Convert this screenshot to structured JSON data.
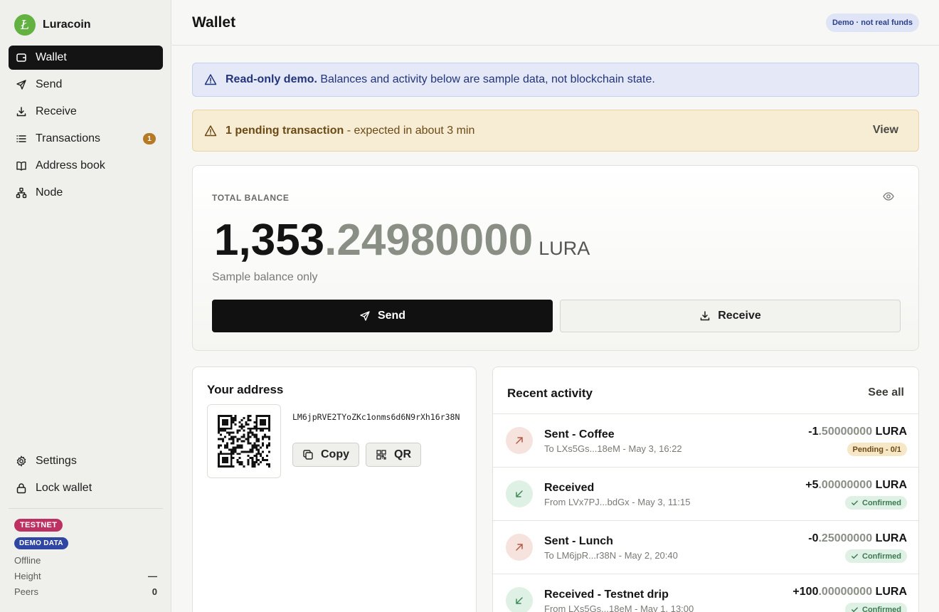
{
  "app": {
    "name": "Luracoin",
    "logo_letter": "Ł",
    "brand_color": "#62b141"
  },
  "sidebar": {
    "items": [
      {
        "label": "Wallet",
        "icon": "wallet-icon",
        "active": true
      },
      {
        "label": "Send",
        "icon": "send-icon"
      },
      {
        "label": "Receive",
        "icon": "download-icon"
      },
      {
        "label": "Transactions",
        "icon": "list-icon",
        "badge": "1"
      },
      {
        "label": "Address book",
        "icon": "book-icon"
      },
      {
        "label": "Node",
        "icon": "node-icon"
      }
    ],
    "bottom_items": [
      {
        "label": "Settings",
        "icon": "gear-icon"
      },
      {
        "label": "Lock wallet",
        "icon": "lock-icon"
      }
    ],
    "network_pill": "TESTNET",
    "data_pill": "DEMO DATA",
    "connection": "Offline",
    "stats": [
      {
        "label": "Height",
        "value": "—"
      },
      {
        "label": "Peers",
        "value": "0"
      }
    ]
  },
  "header": {
    "title": "Wallet",
    "badge": "Demo · not real funds"
  },
  "banners": {
    "info": {
      "bold": "Read-only demo.",
      "text": " Balances and activity below are sample data, not blockchain state."
    },
    "warn": {
      "bold": "1 pending transaction",
      "text": " - expected in about 3 min",
      "action": "View"
    }
  },
  "balance": {
    "label": "TOTAL BALANCE",
    "integer": "1,353",
    "fraction": ".24980000",
    "unit": "LURA",
    "note": "Sample balance only",
    "send_label": "Send",
    "receive_label": "Receive"
  },
  "address": {
    "title": "Your address",
    "value": "LM6jpRVE2TYoZKc1onms6d6N9rXh16r38N",
    "copy_label": "Copy",
    "qr_label": "QR"
  },
  "activity": {
    "title": "Recent activity",
    "see_all": "See all",
    "items": [
      {
        "direction": "out",
        "name": "Sent - Coffee",
        "sub": "To LXs5Gs...18eM - May 3, 16:22",
        "amount_int": "-1",
        "amount_frac": ".50000000",
        "unit": "LURA",
        "status": "Pending - 0/1",
        "status_type": "pending"
      },
      {
        "direction": "in",
        "name": "Received",
        "sub": "From LVx7PJ...bdGx - May 3, 11:15",
        "amount_int": "+5",
        "amount_frac": ".00000000",
        "unit": "LURA",
        "status": "Confirmed",
        "status_type": "confirmed"
      },
      {
        "direction": "out",
        "name": "Sent - Lunch",
        "sub": "To LM6jpR...r38N - May 2, 20:40",
        "amount_int": "-0",
        "amount_frac": ".25000000",
        "unit": "LURA",
        "status": "Confirmed",
        "status_type": "confirmed"
      },
      {
        "direction": "in",
        "name": "Received - Testnet drip",
        "sub": "From LXs5Gs...18eM - May 1, 13:00",
        "amount_int": "+100",
        "amount_frac": ".00000000",
        "unit": "LURA",
        "status": "Confirmed",
        "status_type": "confirmed"
      }
    ]
  }
}
